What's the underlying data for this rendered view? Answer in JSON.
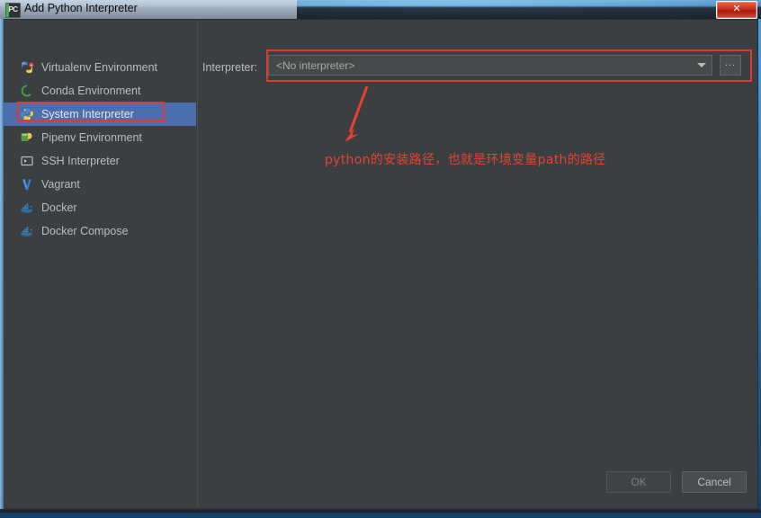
{
  "window": {
    "title": "Add Python Interpreter",
    "app_icon": "PC",
    "close_label": "✕"
  },
  "sidebar": {
    "items": [
      {
        "label": "Virtualenv Environment",
        "icon": "virtualenv-icon",
        "selected": false
      },
      {
        "label": "Conda Environment",
        "icon": "conda-icon",
        "selected": false
      },
      {
        "label": "System Interpreter",
        "icon": "python-icon",
        "selected": true
      },
      {
        "label": "Pipenv Environment",
        "icon": "pipenv-icon",
        "selected": false
      },
      {
        "label": "SSH Interpreter",
        "icon": "ssh-terminal-icon",
        "selected": false
      },
      {
        "label": "Vagrant",
        "icon": "vagrant-icon",
        "selected": false
      },
      {
        "label": "Docker",
        "icon": "docker-icon",
        "selected": false
      },
      {
        "label": "Docker Compose",
        "icon": "docker-compose-icon",
        "selected": false
      }
    ]
  },
  "main": {
    "interpreter_label": "Interpreter:",
    "interpreter_value": "<No interpreter>",
    "browse_label": "...",
    "dropdown_icon": "chevron-down-icon"
  },
  "annotations": {
    "note_text": "python的安装路径，也就是环境变量path的路径",
    "highlight_color": "#e03a2f"
  },
  "footer": {
    "ok_label": "OK",
    "cancel_label": "Cancel"
  },
  "colors": {
    "dialog_bg": "#3c3f41",
    "selection_blue": "#4b6eaf",
    "text": "#bbbbbb",
    "annotation_red": "#e03a2f"
  }
}
